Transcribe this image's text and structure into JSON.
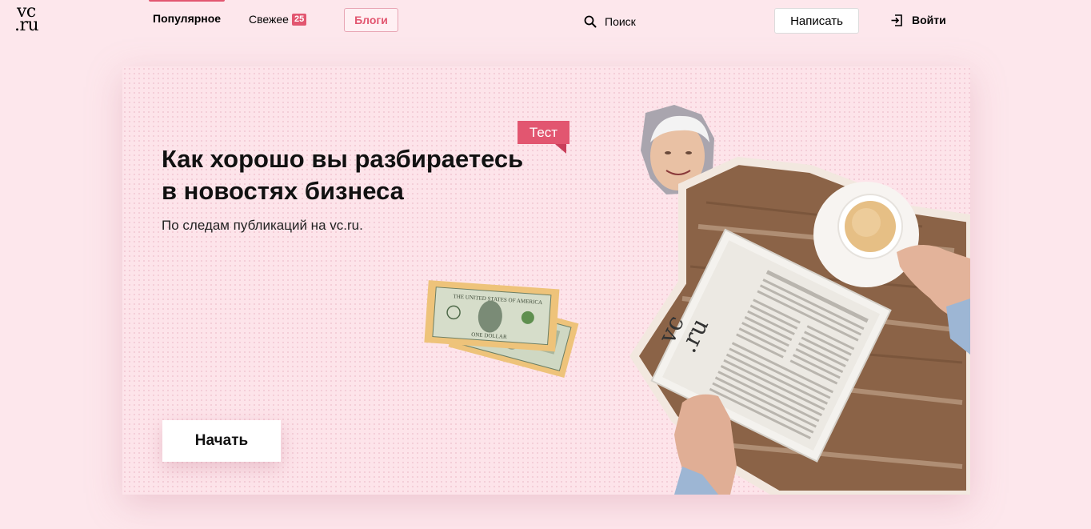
{
  "header": {
    "logo_line1": "vc",
    "logo_line2": ".ru",
    "tabs": [
      {
        "label": "Популярное"
      },
      {
        "label": "Свежее",
        "badge": "25"
      }
    ],
    "blogs_label": "Блоги",
    "search_label": "Поиск",
    "write_label": "Написать",
    "login_label": "Войти"
  },
  "hero": {
    "tag": "Тест",
    "title_line1": "Как хорошо вы разбираетесь",
    "title_line2": "в новостях бизнеса",
    "subtitle": "По следам публикаций на vc.ru.",
    "start_label": "Начать",
    "newspaper_logo_line1": "vc",
    "newspaper_logo_line2": ".ru"
  },
  "colors": {
    "accent": "#e25670",
    "background": "#fde7ec"
  },
  "icons": [
    "search-icon",
    "login-icon"
  ]
}
